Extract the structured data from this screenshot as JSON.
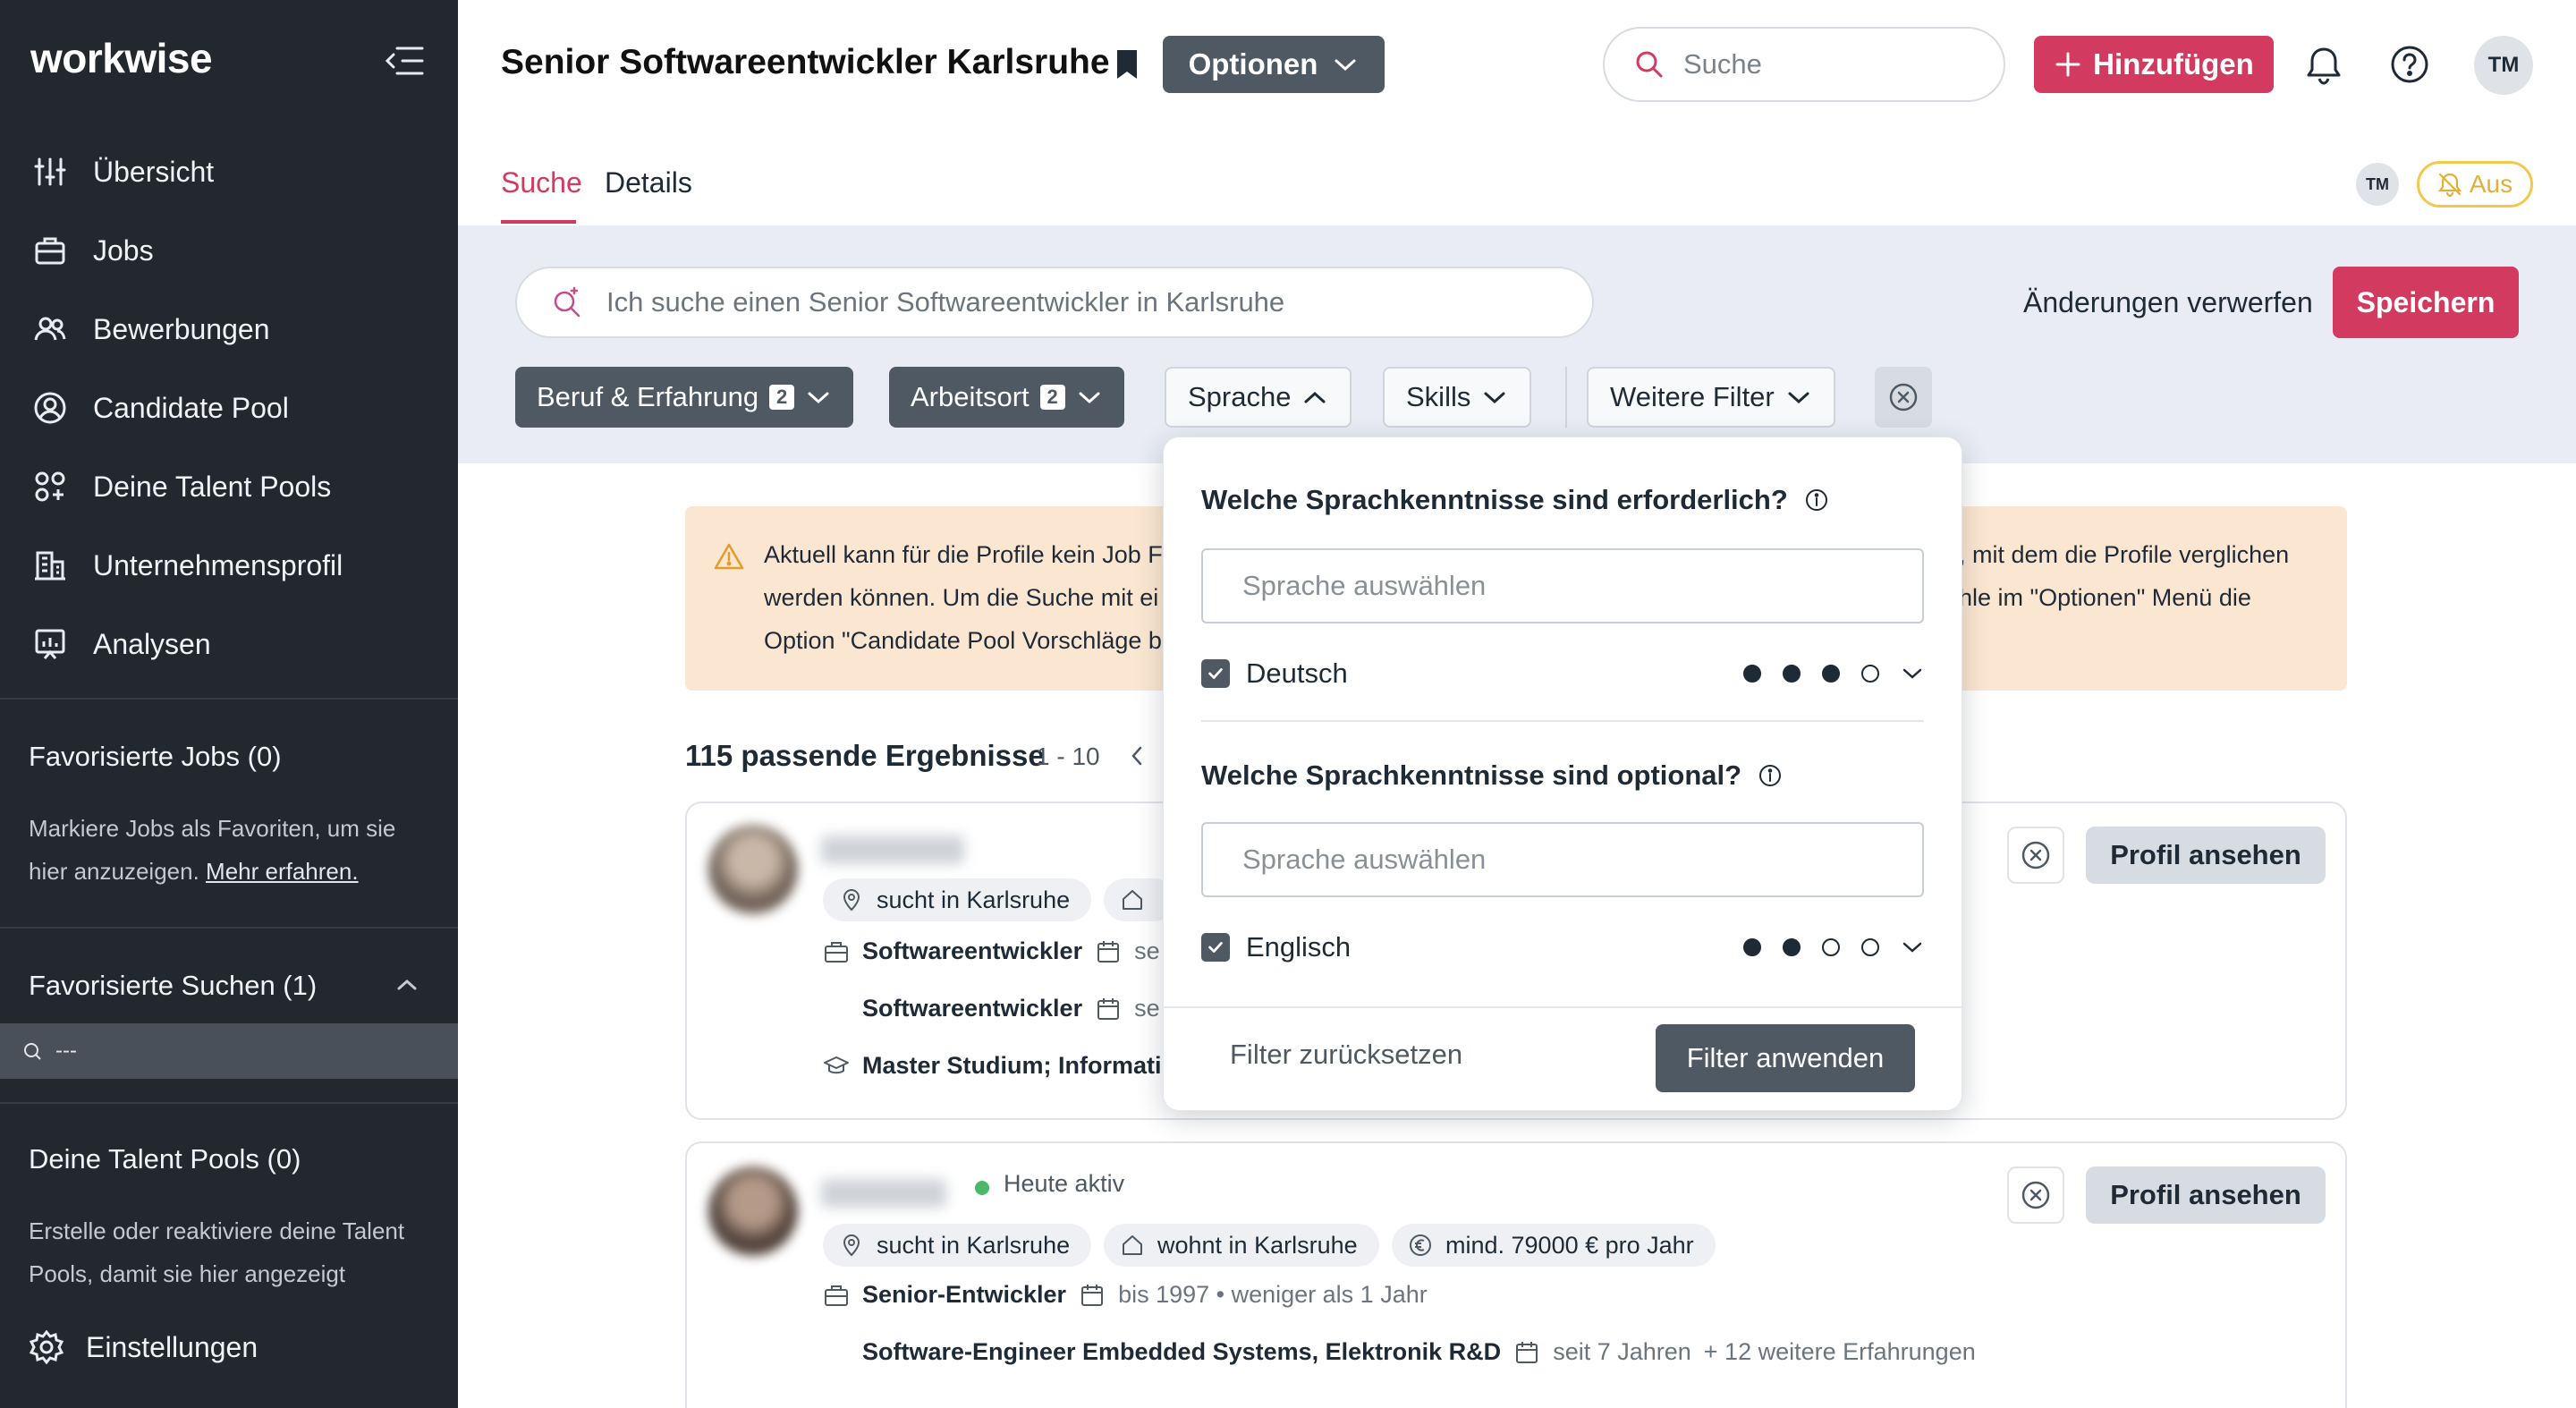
{
  "app": {
    "logo_text": "workwise"
  },
  "sidebar": {
    "items": [
      {
        "label": "Übersicht",
        "icon": "sliders-icon"
      },
      {
        "label": "Jobs",
        "icon": "briefcase-icon"
      },
      {
        "label": "Bewerbungen",
        "icon": "people-icon"
      },
      {
        "label": "Candidate Pool",
        "icon": "user-circle-icon"
      },
      {
        "label": "Deine Talent Pools",
        "icon": "talent-pools-icon"
      },
      {
        "label": "Unternehmensprofil",
        "icon": "building-icon"
      },
      {
        "label": "Analysen",
        "icon": "chart-icon"
      }
    ],
    "fav_jobs": {
      "title": "Favorisierte Jobs (0)",
      "text": "Markiere Jobs als Favoriten, um sie hier anzuzeigen. ",
      "link": "Mehr erfahren."
    },
    "fav_searches": {
      "title": "Favorisierte Suchen (1)",
      "item": "---"
    },
    "talent_pools": {
      "title": "Deine Talent Pools (0)",
      "text": "Erstelle oder reaktiviere deine Talent Pools, damit sie hier angezeigt"
    },
    "settings_label": "Einstellungen"
  },
  "header": {
    "title": "Senior Softwareentwickler Karlsruhe",
    "options_label": "Optionen",
    "search_placeholder": "Suche",
    "add_label": "Hinzufügen",
    "avatar_initials": "TM"
  },
  "tabs": [
    {
      "label": "Suche",
      "active": true
    },
    {
      "label": "Details",
      "active": false
    }
  ],
  "toolbar": {
    "avatar_small": "TM",
    "notify_toggle_label": "Aus"
  },
  "search_bar": {
    "placeholder": "Ich suche einen Senior Softwareentwickler in Karlsruhe",
    "discard_label": "Änderungen verwerfen",
    "save_label": "Speichern"
  },
  "filters": [
    {
      "label": "Beruf & Erfahrung",
      "count": "2",
      "state": "active"
    },
    {
      "label": "Arbeitsort",
      "count": "2",
      "state": "active"
    },
    {
      "label": "Sprache",
      "state": "open"
    },
    {
      "label": "Skills",
      "state": "default"
    },
    {
      "label": "Weitere Filter",
      "state": "default"
    }
  ],
  "warning": {
    "left_text": "Aktuell kann für die Profile kein Job F\nwerden können. Um die Suche mit ei\nOption \"Candidate Pool Vorschläge b",
    "right_text": ", mit dem die Profile verglichen\nhle im \"Optionen\" Menü die"
  },
  "results": {
    "count_label": "115 passende Ergebnisse",
    "range_label": "1 - 10",
    "candidates": [
      {
        "name_hidden": true,
        "location_pill": "sucht in Karlsruhe",
        "experience": [
          {
            "title": "Softwareentwickler",
            "meta": "se"
          },
          {
            "title": "Softwareentwickler",
            "meta": "se"
          }
        ],
        "education": "Master Studium; Informati",
        "view_label": "Profil ansehen"
      },
      {
        "name_hidden": true,
        "status": "Heute aktiv",
        "pills": [
          "sucht in Karlsruhe",
          "wohnt in Karlsruhe",
          "mind. 79000 € pro Jahr"
        ],
        "experience": [
          {
            "title": "Senior-Entwickler",
            "meta": "bis 1997 • weniger als 1 Jahr"
          },
          {
            "title": "Software-Engineer Embedded Systems, Elektronik R&D",
            "meta": "seit 7 Jahren",
            "extra": "+ 12 weitere Erfahrungen"
          }
        ],
        "view_label": "Profil ansehen"
      }
    ]
  },
  "language_dropdown": {
    "required_question": "Welche Sprachkenntnisse sind erforderlich?",
    "required_placeholder": "Sprache auswählen",
    "required_language": {
      "name": "Deutsch",
      "level": 3,
      "max": 4
    },
    "optional_question": "Welche Sprachkenntnisse sind optional?",
    "optional_placeholder": "Sprache auswählen",
    "optional_language": {
      "name": "Englisch",
      "level": 2,
      "max": 4
    },
    "reset_label": "Filter zurücksetzen",
    "apply_label": "Filter anwenden"
  },
  "colors": {
    "accent": "#d23a60",
    "sidebar_bg": "#23272e",
    "chip_dark": "#4e5964",
    "warning_bg": "#fbe7d1",
    "toggle_yellow": "#f2c94c"
  }
}
